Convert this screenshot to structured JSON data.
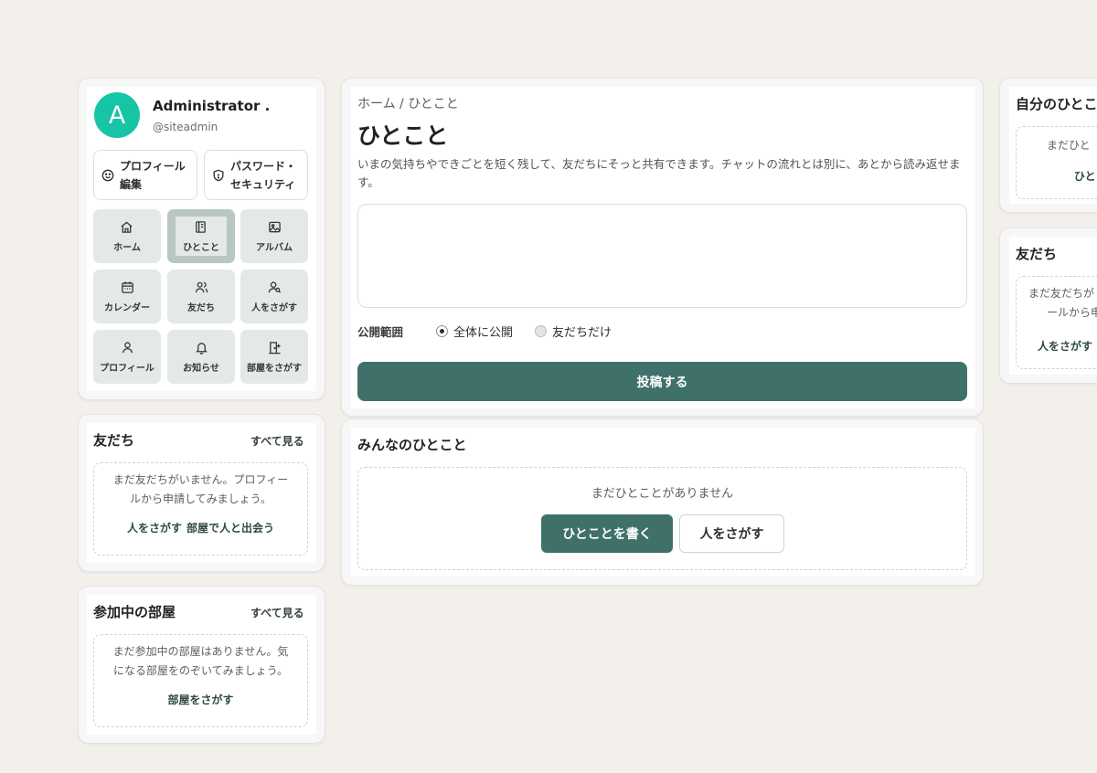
{
  "profile": {
    "avatar_letter": "A",
    "name": "Administrator .",
    "handle": "@siteadmin",
    "edit_profile_line1": "プロフィール",
    "edit_profile_line2": "編集",
    "password_line1": "パスワード・",
    "password_line2": "セキュリティ"
  },
  "nav": {
    "items": [
      {
        "label": "ホーム",
        "icon": "home-icon"
      },
      {
        "label": "ひとこと",
        "icon": "notebook-icon",
        "active": true
      },
      {
        "label": "アルバム",
        "icon": "image-icon"
      },
      {
        "label": "カレンダー",
        "icon": "calendar-icon"
      },
      {
        "label": "友だち",
        "icon": "users-icon"
      },
      {
        "label": "人をさがす",
        "icon": "user-search-icon"
      },
      {
        "label": "プロフィール",
        "icon": "user-icon"
      },
      {
        "label": "お知らせ",
        "icon": "bell-icon"
      },
      {
        "label": "部屋をさがす",
        "icon": "door-icon"
      }
    ]
  },
  "friends_card": {
    "title": "友だち",
    "see_all": "すべて見る",
    "empty_line1": "まだ友だちがいません。プロフィー",
    "empty_line2": "ルから申請してみましょう。",
    "link1": "人をさがす",
    "link2": "部屋で人と出会う"
  },
  "rooms_card": {
    "title": "参加中の部屋",
    "see_all": "すべて見る",
    "empty_line1": "まだ参加中の部屋はありません。気",
    "empty_line2": "になる部屋をのぞいてみましょう。",
    "link": "部屋をさがす"
  },
  "main": {
    "breadcrumb": "ホーム / ひとこと",
    "title": "ひとこと",
    "description": "いまの気持ちやできごとを短く残して、友だちにそっと共有できます。チャットの流れとは別に、あとから読み返せます。",
    "textarea_placeholder": "",
    "scope_label": "公開範囲",
    "scope_public": "全体に公開",
    "scope_friends": "友だちだけ",
    "post_button": "投稿する"
  },
  "everyone": {
    "title": "みんなのひとこと",
    "empty": "まだひとことがありません",
    "write_button": "ひとことを書く",
    "find_button": "人をさがす"
  },
  "right_mine": {
    "title": "自分のひとこと",
    "empty": "まだひと",
    "link": "ひと"
  },
  "right_friends": {
    "title": "友だち",
    "empty_line1": "まだ友だちが",
    "empty_line2": "ールから申請",
    "link": "人をさがす"
  },
  "colors": {
    "accent": "#3f716a",
    "avatar": "#16c4a6",
    "background": "#f3f0eb"
  }
}
